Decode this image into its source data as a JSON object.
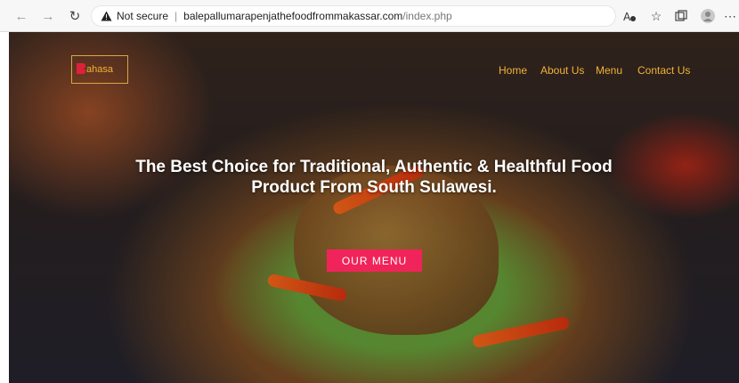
{
  "browser": {
    "security_label": "Not secure",
    "url_host": "balepallumarapenjathefoodfrommakassar.com",
    "url_path": "/index.php",
    "icons": [
      "back-icon",
      "forward-icon",
      "refresh-icon",
      "warning-icon",
      "read-aloud-icon",
      "favorites-icon",
      "collections-icon",
      "profile-icon",
      "more-icon"
    ]
  },
  "site": {
    "logo_text": "ahasa",
    "nav": [
      "Home",
      "About Us",
      "Menu",
      "Contact Us"
    ],
    "headline_line1": "The Best Choice for Traditional, Authentic & Healthful Food",
    "headline_line2": "Product From South Sulawesi.",
    "cta_label": "OUR MENU",
    "colors": {
      "accent": "#f0b336",
      "cta": "#f0245a"
    }
  }
}
